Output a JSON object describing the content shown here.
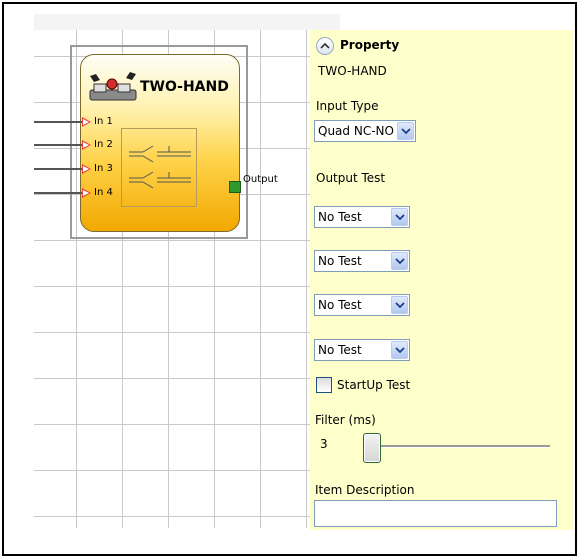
{
  "block": {
    "title": "TWO-HAND",
    "inputs": [
      "In 1",
      "In 2",
      "In 3",
      "In 4"
    ],
    "output": "Output"
  },
  "property": {
    "header": "Property",
    "subtitle": "TWO-HAND",
    "input_type": {
      "label": "Input Type",
      "value": "Quad NC-NO"
    },
    "output_test": {
      "label": "Output Test",
      "values": [
        "No Test",
        "No Test",
        "No Test",
        "No Test"
      ]
    },
    "startup_test": {
      "label": "StartUp Test",
      "checked": false
    },
    "filter": {
      "label": "Filter (ms)",
      "value": "3"
    },
    "item_description": {
      "label": "Item Description",
      "value": ""
    }
  },
  "icons": {
    "collapse": "chevron-up-icon",
    "dropdown": "chevron-down-icon",
    "block": "two-hand-switch-icon"
  },
  "colors": {
    "panel_bg": "#ffffcc",
    "block_top": "#fffef6",
    "block_bottom": "#f2a800",
    "input_arrow": "#e8453c",
    "output_port": "#2e9a2e"
  }
}
